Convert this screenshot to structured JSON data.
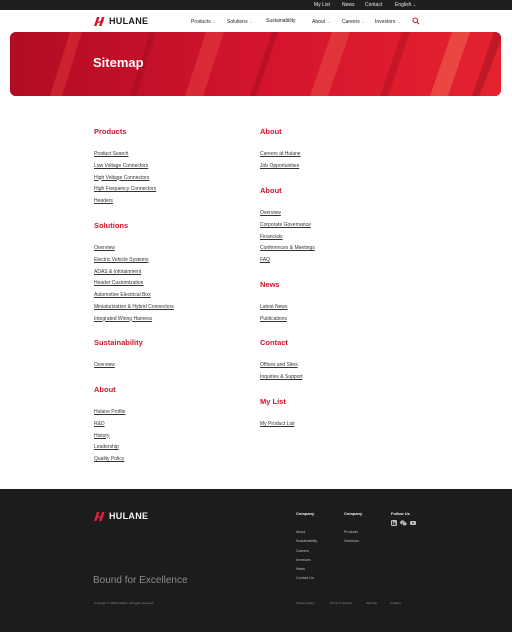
{
  "topbar": {
    "links": [
      "My List",
      "News",
      "Contact"
    ],
    "language": "English",
    "language_caret": "⌄"
  },
  "brand": {
    "name": "HULANE",
    "accent_color": "#d0142c"
  },
  "nav": {
    "items": [
      {
        "label": "Products",
        "has_menu": true
      },
      {
        "label": "Solutions",
        "has_menu": true
      },
      {
        "label": "Sustainability",
        "has_menu": false
      },
      {
        "label": "About",
        "has_menu": true
      },
      {
        "label": "Careers",
        "has_menu": true
      },
      {
        "label": "Investors",
        "has_menu": true
      }
    ],
    "caret": "⌄",
    "search_icon": "search-icon"
  },
  "hero": {
    "title": "Sitemap"
  },
  "sitemap": {
    "products": {
      "title": "Products",
      "links": [
        "Product Search",
        "Low Voltage Connectors",
        "High Voltage Connectors",
        "High Frequency Connectors",
        "Headers"
      ]
    },
    "solutions": {
      "title": "Solutions",
      "links": [
        "Overview",
        "Electric Vehicle Systems",
        "ADAS & Infotainment",
        "Header Customization",
        "Automotive Electrical Box",
        "Miniaturization & Hybrid Connectors",
        "Integrated Wiring Harness"
      ]
    },
    "sustainability": {
      "title": "Sustainability",
      "links": [
        "Overview"
      ]
    },
    "about_left": {
      "title": "About",
      "links": [
        "Hulane Profile",
        "R&D",
        "History",
        "Leadership",
        "Quality Policy"
      ]
    },
    "about_careers": {
      "title": "About",
      "links": [
        "Careers at Hulane",
        "Job Opportunities"
      ]
    },
    "about_investors": {
      "title": "About",
      "links": [
        "Overview",
        "Corporate Governance",
        "Financials",
        "Conferences & Meetings",
        "FAQ"
      ]
    },
    "news": {
      "title": "News",
      "links": [
        "Latest News",
        "Publications"
      ]
    },
    "contact": {
      "title": "Contact",
      "links": [
        "Offices and Sites",
        "Inquiries & Support"
      ]
    },
    "my_list": {
      "title": "My List",
      "links": [
        "My Product List"
      ]
    }
  },
  "footer": {
    "company_col": {
      "title": "Company",
      "links": [
        "About",
        "Sustainability",
        "Careers",
        "Investors",
        "News",
        "Contact Us"
      ]
    },
    "company_col2": {
      "title": "Company",
      "links": [
        "Products",
        "Solutions"
      ]
    },
    "follow": {
      "title": "Follow Us",
      "icons": [
        "linkedin-icon",
        "wechat-icon",
        "youtube-icon"
      ]
    },
    "tagline": "Bound for Excellence",
    "copyright": "Copyright © 2024 Hulane. All rights reserved.",
    "legal_links": [
      "Privacy Policy",
      "Terms of Service",
      "Sitemap",
      "Cookies"
    ]
  }
}
